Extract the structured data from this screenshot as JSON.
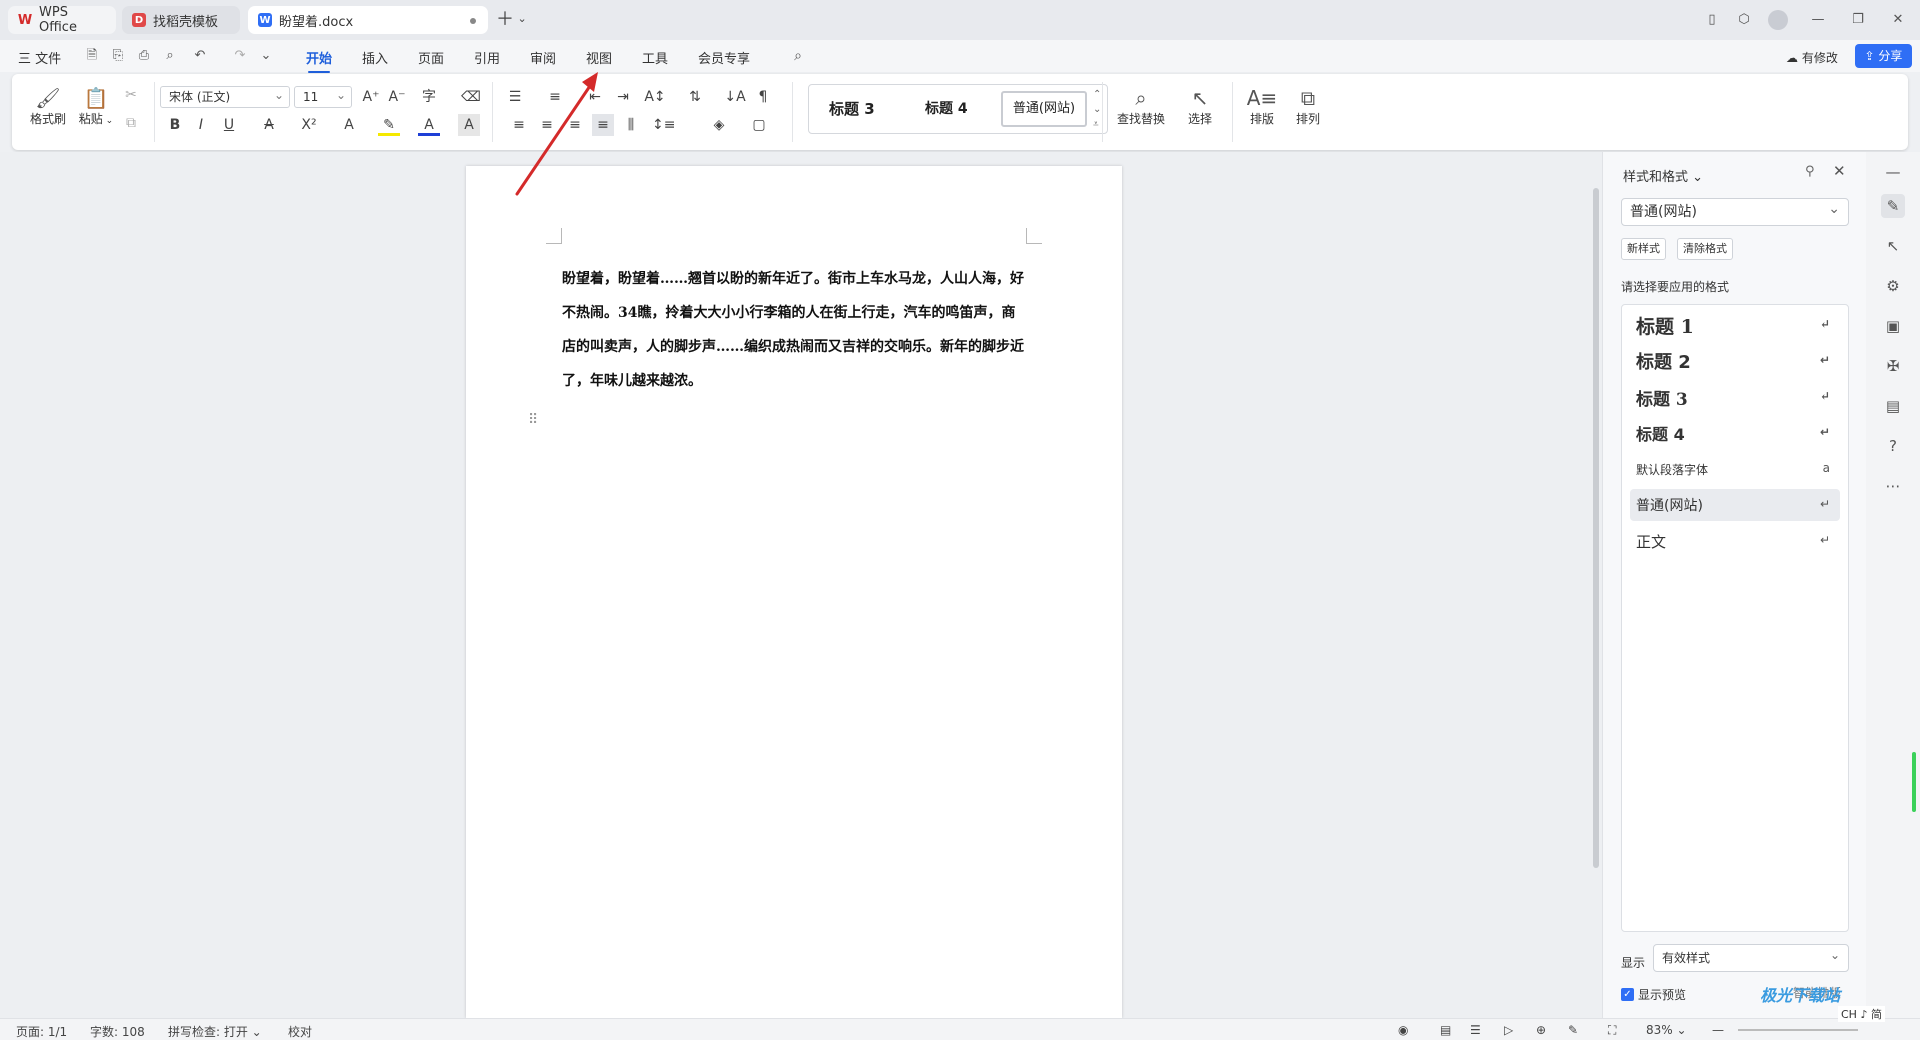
{
  "tabs": [
    {
      "label": "WPS Office",
      "icon": "wps-logo-icon"
    },
    {
      "label": "找稻壳模板",
      "icon": "docer-icon"
    },
    {
      "label": "盼望着.docx",
      "icon": "word-doc-icon"
    }
  ],
  "menu": {
    "file": "三 文件",
    "items": [
      "开始",
      "插入",
      "页面",
      "引用",
      "审阅",
      "视图",
      "工具",
      "会员专享"
    ],
    "active": "开始",
    "modified_label": "有修改",
    "share_label": "分享"
  },
  "ribbon": {
    "format_painter": "格式刷",
    "paste": "粘贴",
    "font_name": "宋体 (正文)",
    "font_size": "11",
    "style_gallery": [
      "标题 3",
      "标题 4",
      "普通(网站)"
    ],
    "find_replace": "查找替换",
    "select": "选择",
    "layout": "排版",
    "arrange": "排列"
  },
  "document": {
    "paragraph": "盼望着，盼望着……翘首以盼的新年近了。街市上车水马龙，人山人海，好不热闹。34瞧，拎着大大小小行李箱的人在街上行走，汽车的鸣笛声，商店的叫卖声，人的脚步声……编织成热闹而又吉祥的交响乐。新年的脚步近了，年味儿越来越浓。"
  },
  "panel": {
    "title": "样式和格式",
    "current_style": "普通(网站)",
    "new_style": "新样式",
    "clear_format": "清除格式",
    "prompt": "请选择要应用的格式",
    "styles": [
      {
        "label": "标题 1",
        "mark": "↵"
      },
      {
        "label": "标题 2",
        "mark": "↵"
      },
      {
        "label": "标题 3",
        "mark": "↵"
      },
      {
        "label": "标题 4",
        "mark": "↵"
      },
      {
        "label": "默认段落字体",
        "mark": "a"
      },
      {
        "label": "普通(网站)",
        "mark": "↵"
      },
      {
        "label": "正文",
        "mark": "↵"
      }
    ],
    "selected_index": 5,
    "show_label": "显示",
    "show_value": "有效样式",
    "show_preview": "显示预览",
    "smart_layout": "智能排版"
  },
  "status": {
    "page": "页面: 1/1",
    "words": "字数: 108",
    "spellcheck": "拼写检查: 打开",
    "proof": "校对",
    "zoom": "83%"
  },
  "watermark": "极光下载站",
  "ime": "CH ♪ 简",
  "colors": {
    "accent": "#1f5fdb",
    "share": "#2f6ef5",
    "arrow": "#d42a2a"
  }
}
